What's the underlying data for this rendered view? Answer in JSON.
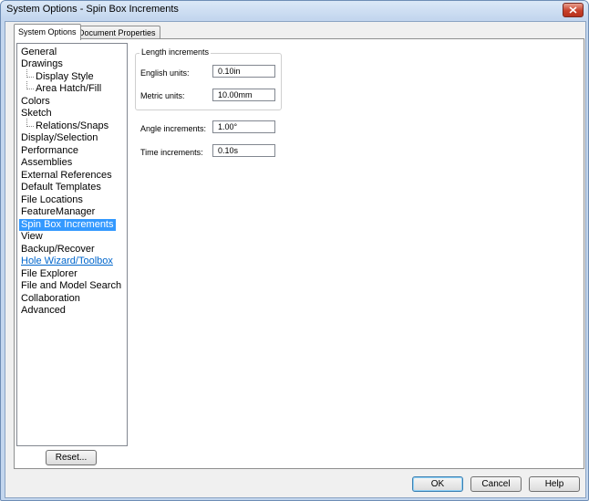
{
  "window": {
    "title": "System Options - Spin Box Increments"
  },
  "tabs": [
    {
      "label": "System Options",
      "active": true
    },
    {
      "label": "Document Properties",
      "active": false
    }
  ],
  "tree": {
    "items": [
      {
        "label": "General"
      },
      {
        "label": "Drawings"
      },
      {
        "label": "Display Style",
        "child": true
      },
      {
        "label": "Area Hatch/Fill",
        "child": true
      },
      {
        "label": "Colors"
      },
      {
        "label": "Sketch"
      },
      {
        "label": "Relations/Snaps",
        "child": true
      },
      {
        "label": "Display/Selection"
      },
      {
        "label": "Performance"
      },
      {
        "label": "Assemblies"
      },
      {
        "label": "External References"
      },
      {
        "label": "Default Templates"
      },
      {
        "label": "File Locations"
      },
      {
        "label": "FeatureManager"
      },
      {
        "label": "Spin Box Increments",
        "selected": true
      },
      {
        "label": "View"
      },
      {
        "label": "Backup/Recover"
      },
      {
        "label": "Hole Wizard/Toolbox",
        "link": true
      },
      {
        "label": "File Explorer"
      },
      {
        "label": "File and Model Search"
      },
      {
        "label": "Collaboration"
      },
      {
        "label": "Advanced"
      }
    ]
  },
  "settings": {
    "length_group_label": "Length increments",
    "english_label": "English units:",
    "english_value": "0.10in",
    "metric_label": "Metric units:",
    "metric_value": "10.00mm",
    "angle_label": "Angle increments:",
    "angle_value": "1.00°",
    "time_label": "Time increments:",
    "time_value": "0.10s"
  },
  "buttons": {
    "reset": "Reset...",
    "ok": "OK",
    "cancel": "Cancel",
    "help": "Help"
  },
  "colors": {
    "selection": "#3399ff",
    "link": "#0066cc"
  }
}
